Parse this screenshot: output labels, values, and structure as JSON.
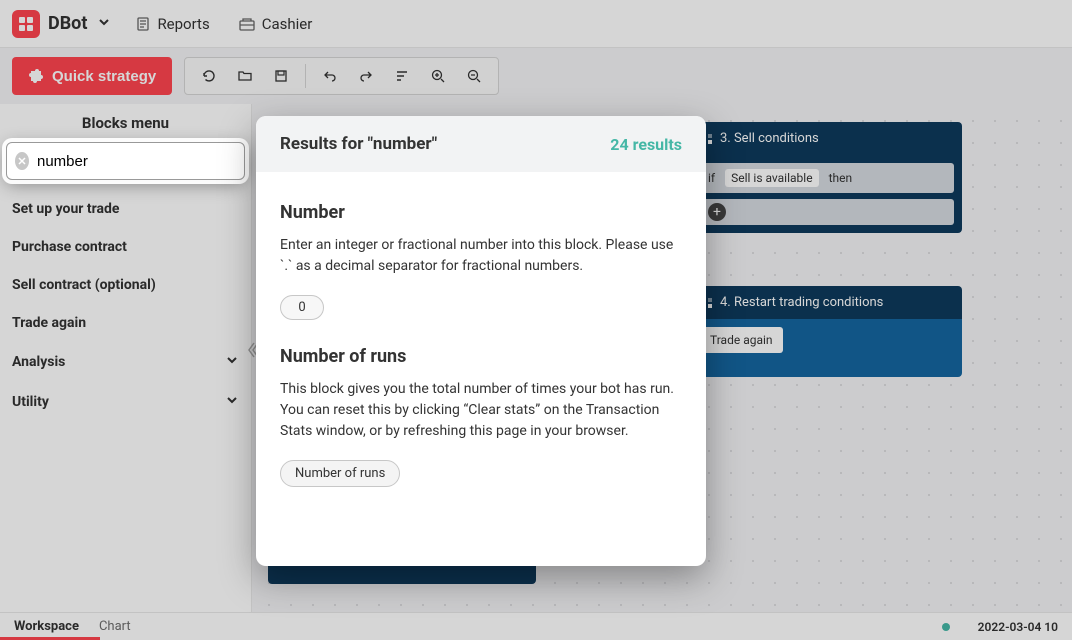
{
  "brand": {
    "name": "DBot"
  },
  "top_nav": {
    "reports": "Reports",
    "cashier": "Cashier"
  },
  "toolbar": {
    "quick_strategy": "Quick strategy"
  },
  "sidebar": {
    "title": "Blocks menu",
    "search_value": "number",
    "items": [
      {
        "label": "Set up your trade"
      },
      {
        "label": "Purchase contract"
      },
      {
        "label": "Sell contract (optional)"
      },
      {
        "label": "Trade again"
      },
      {
        "label": "Analysis"
      },
      {
        "label": "Utility"
      }
    ]
  },
  "modal": {
    "title": "Results for \"number\"",
    "count_label": "24 results",
    "results": [
      {
        "title": "Number",
        "desc": "Enter an integer or fractional number into this block. Please use `.` as a decimal separator for fractional numbers.",
        "value": "0"
      },
      {
        "title": "Number of runs",
        "desc": "This block gives you the total number of times your bot has run. You can reset this by clicking “Clear stats” on the Transaction Stats window, or by refreshing this page in your browser.",
        "pill": "Number of runs"
      }
    ]
  },
  "canvas": {
    "block3": {
      "title": "3. Sell conditions",
      "if_label": "if",
      "cond_label": "Sell is available",
      "then_label": "then"
    },
    "block4": {
      "title": "4. Restart trading conditions",
      "trade_again": "Trade again"
    }
  },
  "footer": {
    "workspace": "Workspace",
    "chart": "Chart",
    "datetime": "2022-03-04 10"
  }
}
